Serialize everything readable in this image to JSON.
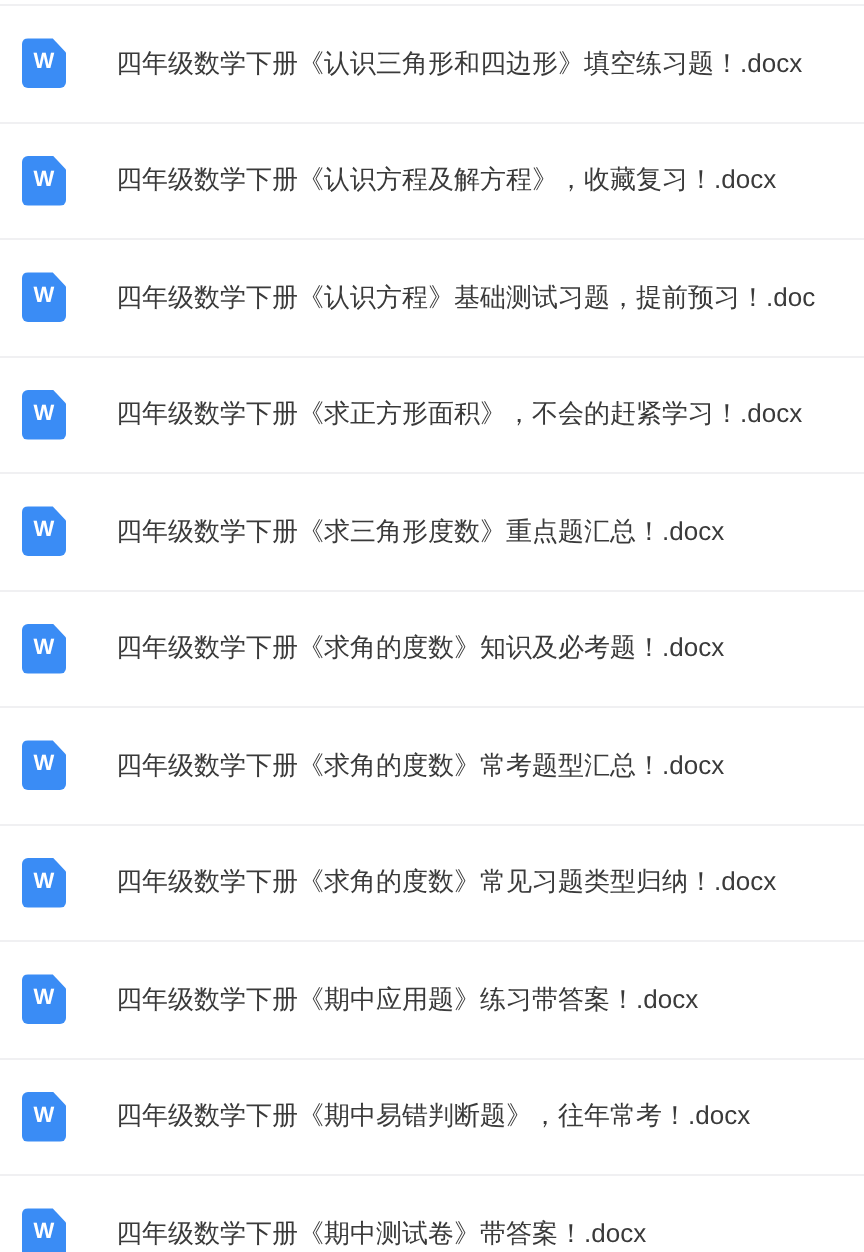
{
  "files": [
    {
      "icon_letter": "W",
      "name": "四年级数学下册《认识三角形和四边形》填空练习题！.docx"
    },
    {
      "icon_letter": "W",
      "name": "四年级数学下册《认识方程及解方程》，收藏复习！.docx"
    },
    {
      "icon_letter": "W",
      "name": "四年级数学下册《认识方程》基础测试习题，提前预习！.doc"
    },
    {
      "icon_letter": "W",
      "name": "四年级数学下册《求正方形面积》，不会的赶紧学习！.docx"
    },
    {
      "icon_letter": "W",
      "name": "四年级数学下册《求三角形度数》重点题汇总！.docx"
    },
    {
      "icon_letter": "W",
      "name": "四年级数学下册《求角的度数》知识及必考题！.docx"
    },
    {
      "icon_letter": "W",
      "name": "四年级数学下册《求角的度数》常考题型汇总！.docx"
    },
    {
      "icon_letter": "W",
      "name": "四年级数学下册《求角的度数》常见习题类型归纳！.docx"
    },
    {
      "icon_letter": "W",
      "name": "四年级数学下册《期中应用题》练习带答案！.docx"
    },
    {
      "icon_letter": "W",
      "name": "四年级数学下册《期中易错判断题》，往年常考！.docx"
    },
    {
      "icon_letter": "W",
      "name": "四年级数学下册《期中测试卷》带答案！.docx"
    }
  ]
}
